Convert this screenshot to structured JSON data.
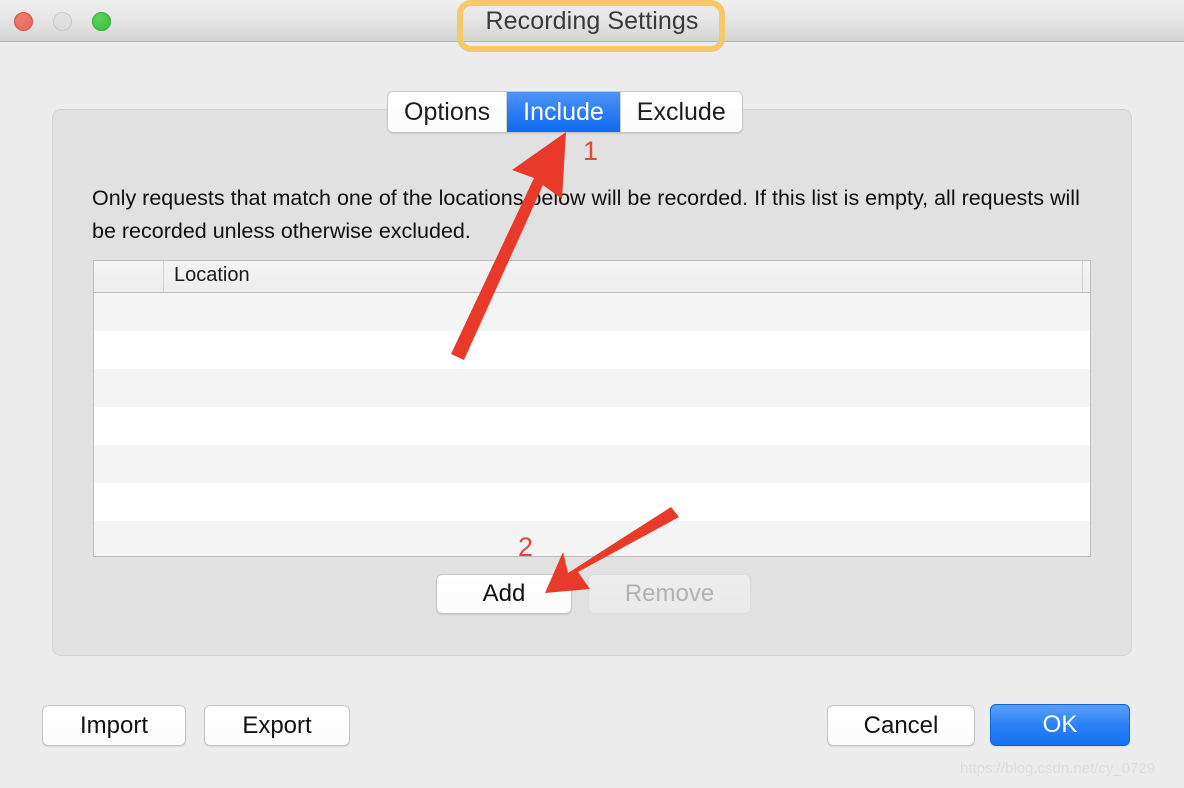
{
  "window": {
    "title": "Recording Settings",
    "traffic_lights": [
      "close-button",
      "minimize-button",
      "zoom-button"
    ]
  },
  "tabs": [
    {
      "label": "Options",
      "selected": false
    },
    {
      "label": "Include",
      "selected": true
    },
    {
      "label": "Exclude",
      "selected": false
    }
  ],
  "panel": {
    "description": "Only requests that match one of the locations below will be recorded. If this list is empty, all requests will be recorded unless otherwise excluded."
  },
  "table": {
    "columns": [
      "",
      "Location"
    ],
    "rows": [],
    "empty_row_count": 7
  },
  "list_buttons": {
    "add_label": "Add",
    "remove_label": "Remove",
    "remove_disabled": true
  },
  "footer": {
    "import_label": "Import",
    "export_label": "Export",
    "cancel_label": "Cancel",
    "ok_label": "OK"
  },
  "annotations": {
    "number_1": "1",
    "number_2": "2",
    "arrow_color": "#e8392a",
    "highlight_color": "#f5c96a"
  },
  "watermark": "https://blog.csdn.net/cy_0729"
}
